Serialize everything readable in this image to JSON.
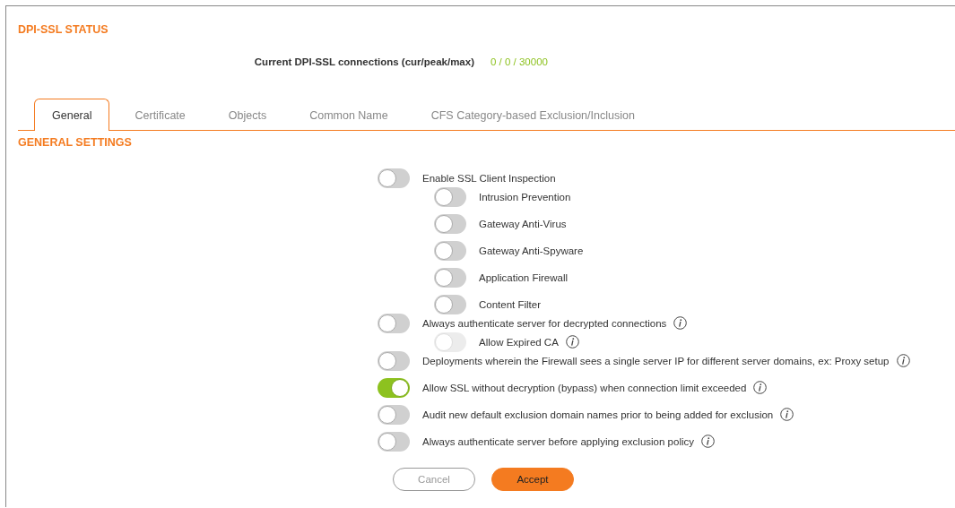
{
  "status": {
    "heading": "DPI-SSL STATUS",
    "label": "Current DPI-SSL connections (cur/peak/max)",
    "value": "0 / 0 / 30000"
  },
  "tabs": [
    {
      "label": "General",
      "selected": true
    },
    {
      "label": "Certificate",
      "selected": false
    },
    {
      "label": "Objects",
      "selected": false
    },
    {
      "label": "Common Name",
      "selected": false
    },
    {
      "label": "CFS Category-based Exclusion/Inclusion",
      "selected": false
    }
  ],
  "section_heading": "GENERAL SETTINGS",
  "settings": [
    {
      "label": "Enable SSL Client Inspection",
      "on": false,
      "disabled": false,
      "info": false,
      "children": [
        {
          "label": "Intrusion Prevention",
          "on": false,
          "disabled": false,
          "info": false
        },
        {
          "label": "Gateway Anti-Virus",
          "on": false,
          "disabled": false,
          "info": false
        },
        {
          "label": "Gateway Anti-Spyware",
          "on": false,
          "disabled": false,
          "info": false
        },
        {
          "label": "Application Firewall",
          "on": false,
          "disabled": false,
          "info": false
        },
        {
          "label": "Content Filter",
          "on": false,
          "disabled": false,
          "info": false
        }
      ]
    },
    {
      "label": "Always authenticate server for decrypted connections",
      "on": false,
      "disabled": false,
      "info": true,
      "children": [
        {
          "label": "Allow Expired CA",
          "on": false,
          "disabled": true,
          "info": true
        }
      ]
    },
    {
      "label": "Deployments wherein the Firewall sees a single server IP for different server domains, ex: Proxy setup",
      "on": false,
      "disabled": false,
      "info": true
    },
    {
      "label": "Allow SSL without decryption (bypass) when connection limit exceeded",
      "on": true,
      "disabled": false,
      "info": true
    },
    {
      "label": "Audit new default exclusion domain names prior to being added for exclusion",
      "on": false,
      "disabled": false,
      "info": true
    },
    {
      "label": "Always authenticate server before applying exclusion policy",
      "on": false,
      "disabled": false,
      "info": true
    }
  ],
  "buttons": [
    {
      "label": "Cancel",
      "kind": "secondary"
    },
    {
      "label": "Accept",
      "kind": "primary"
    }
  ]
}
